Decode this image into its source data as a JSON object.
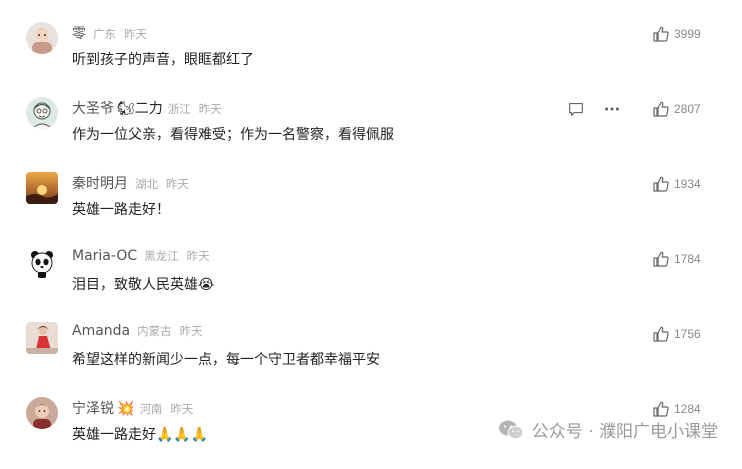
{
  "comments": [
    {
      "username": "零",
      "badge": "",
      "location": "广东",
      "time": "昨天",
      "content": "听到孩子的声音，眼眶都红了",
      "likes": "3999",
      "avatar_icon": "baby-photo-avatar"
    },
    {
      "username": "大圣爷",
      "badge": "🐿二力",
      "location": "浙江",
      "time": "昨天",
      "content": "作为一位父亲，看得难受；作为一名警察，看得佩服",
      "likes": "2807",
      "avatar_icon": "sketch-man-avatar",
      "show_actions": true
    },
    {
      "username": "秦时明月",
      "badge": "",
      "location": "湖北",
      "time": "昨天",
      "content": "英雄一路走好！",
      "likes": "1934",
      "avatar_icon": "sunset-avatar"
    },
    {
      "username": "Maria-OC",
      "badge": "",
      "location": "黑龙江",
      "time": "昨天",
      "content": "泪目，致敬人民英雄😭",
      "likes": "1784",
      "avatar_icon": "panda-avatar"
    },
    {
      "username": "Amanda",
      "badge": "",
      "location": "内蒙古",
      "time": "昨天",
      "content": "希望这样的新闻少一点，每一个守卫者都幸福平安",
      "likes": "1756",
      "avatar_icon": "red-dress-avatar"
    },
    {
      "username": "宁泽锐",
      "badge": "💥",
      "location": "河南",
      "time": "昨天",
      "content": "英雄一路走好🙏🙏🙏",
      "likes": "1284",
      "avatar_icon": "child-photo-avatar"
    }
  ],
  "watermark": {
    "text": "公众号 · 濮阳广电小课堂",
    "icon": "wechat-icon"
  }
}
